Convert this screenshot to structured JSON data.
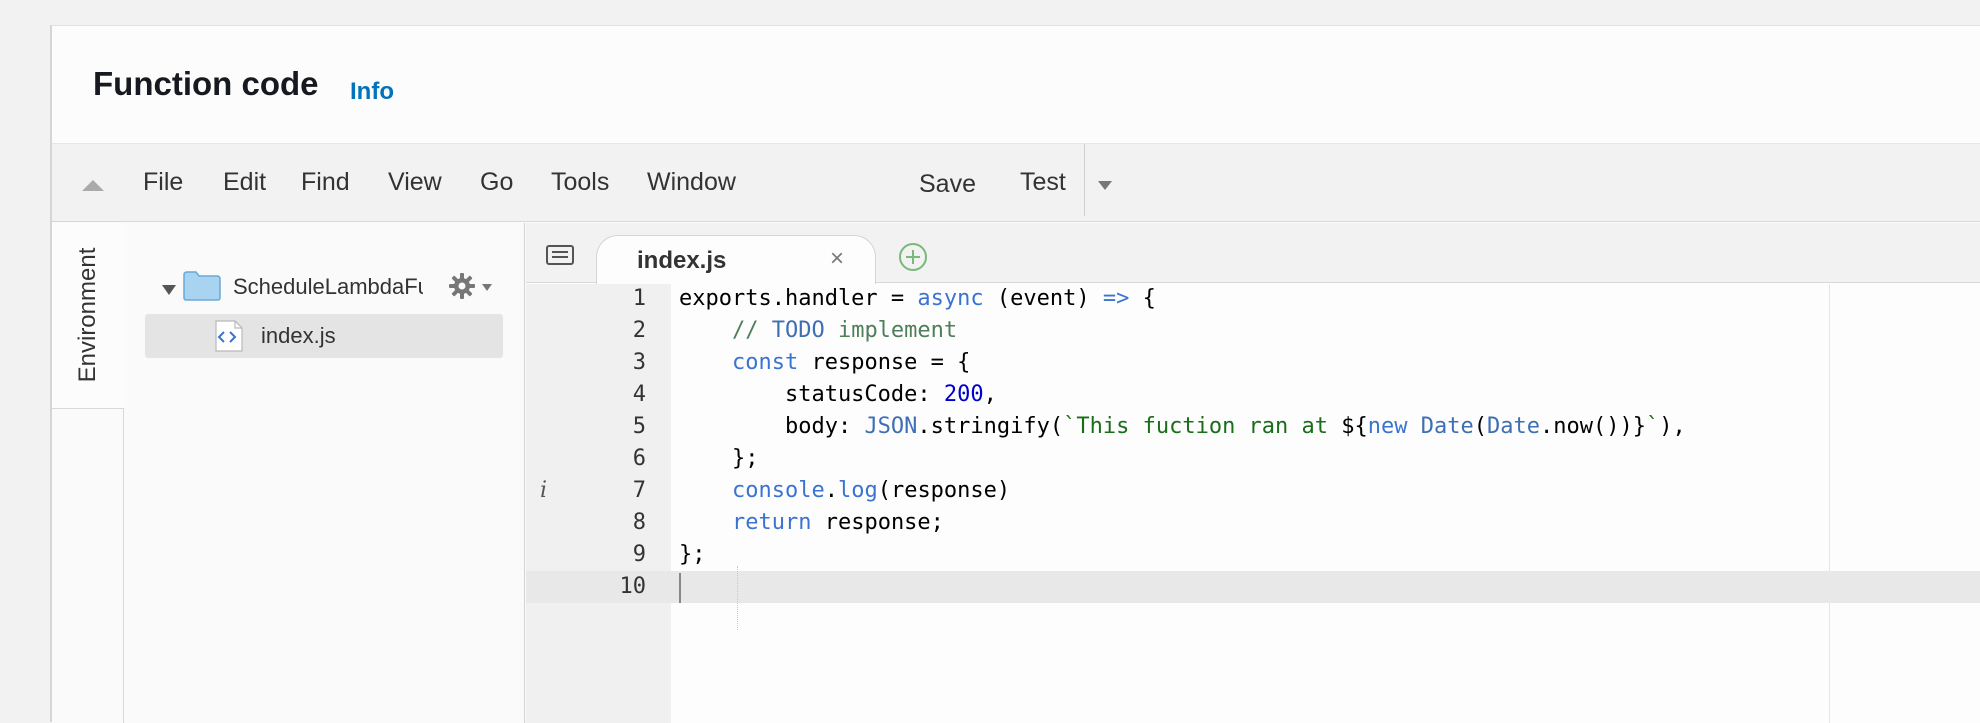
{
  "panel": {
    "title": "Function code",
    "info_link": "Info"
  },
  "menu": {
    "items": [
      "File",
      "Edit",
      "Find",
      "View",
      "Go",
      "Tools",
      "Window"
    ],
    "save": "Save",
    "test": "Test"
  },
  "sidebar": {
    "environment_tab": "Environment",
    "folder_name": "ScheduleLambdaFunction",
    "file_name": "index.js"
  },
  "editor": {
    "active_tab": "index.js",
    "close_glyph": "×",
    "line_numbers": [
      "1",
      "2",
      "3",
      "4",
      "5",
      "6",
      "7",
      "8",
      "9",
      "10"
    ],
    "info_marker": "i",
    "lines": [
      [
        {
          "t": "exports.handler = ",
          "c": ""
        },
        {
          "t": "async",
          "c": "kw"
        },
        {
          "t": " (event) ",
          "c": ""
        },
        {
          "t": "=>",
          "c": "kw"
        },
        {
          "t": " {",
          "c": ""
        }
      ],
      [
        {
          "t": "    // ",
          "c": "cm"
        },
        {
          "t": "TODO",
          "c": "obj"
        },
        {
          "t": " implement",
          "c": "cm"
        }
      ],
      [
        {
          "t": "    ",
          "c": ""
        },
        {
          "t": "const",
          "c": "kw"
        },
        {
          "t": " response = {",
          "c": ""
        }
      ],
      [
        {
          "t": "        statusCode: ",
          "c": ""
        },
        {
          "t": "200",
          "c": "num"
        },
        {
          "t": ",",
          "c": ""
        }
      ],
      [
        {
          "t": "        body: ",
          "c": ""
        },
        {
          "t": "JSON",
          "c": "obj"
        },
        {
          "t": ".stringify(",
          "c": ""
        },
        {
          "t": "`This fuction ran at ",
          "c": "str"
        },
        {
          "t": "${",
          "c": ""
        },
        {
          "t": "new",
          "c": "kw"
        },
        {
          "t": " ",
          "c": ""
        },
        {
          "t": "Date",
          "c": "obj"
        },
        {
          "t": "(",
          "c": ""
        },
        {
          "t": "Date",
          "c": "obj"
        },
        {
          "t": ".now())}",
          "c": ""
        },
        {
          "t": "`",
          "c": "str"
        },
        {
          "t": "),",
          "c": ""
        }
      ],
      [
        {
          "t": "    };",
          "c": ""
        }
      ],
      [
        {
          "t": "    ",
          "c": ""
        },
        {
          "t": "console",
          "c": "kw"
        },
        {
          "t": ".",
          "c": ""
        },
        {
          "t": "log",
          "c": "kw"
        },
        {
          "t": "(response)",
          "c": ""
        }
      ],
      [
        {
          "t": "    ",
          "c": ""
        },
        {
          "t": "return",
          "c": "kw"
        },
        {
          "t": " response;",
          "c": ""
        }
      ],
      [
        {
          "t": "};",
          "c": ""
        }
      ],
      []
    ]
  }
}
